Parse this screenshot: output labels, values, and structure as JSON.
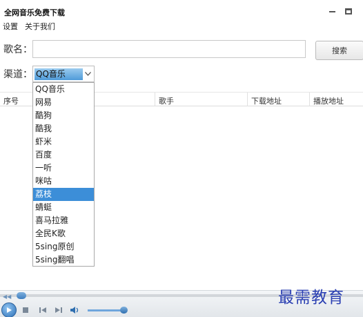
{
  "window": {
    "title": "全网音乐免费下载",
    "minimize_icon": "minimize-icon",
    "maximize_icon": "maximize-icon"
  },
  "menu": {
    "items": [
      "设置",
      "关于我们"
    ]
  },
  "form": {
    "song_label": "歌名：",
    "song_value": "",
    "search_label": "搜索",
    "channel_label": "渠道：",
    "channel_selected": "QQ音乐"
  },
  "table": {
    "columns": [
      "序号",
      "歌手",
      "下载地址",
      "播放地址"
    ]
  },
  "channel_options": [
    "QQ音乐",
    "网易",
    "酷狗",
    "酷我",
    "虾米",
    "百度",
    "一听",
    "咪咕",
    "荔枝",
    "蜻蜓",
    "喜马拉雅",
    "全民K歌",
    "5sing原创",
    "5sing翻唱"
  ],
  "highlighted_option": "荔枝",
  "player": {
    "icons": [
      "play-icon",
      "stop-icon",
      "previous-icon",
      "next-icon",
      "volume-icon"
    ],
    "accent": "#3c8ed8"
  },
  "watermark": "最需教育"
}
